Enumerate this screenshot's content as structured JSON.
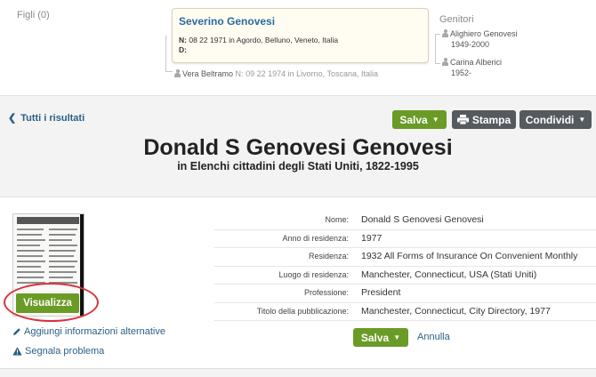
{
  "family": {
    "children_label": "Figli (0)",
    "person": {
      "name": "Severino Genovesi",
      "birth_label": "N:",
      "birth_value": "08 22 1971 in Agordo, Belluno, Veneto, Italia",
      "death_label": "D:",
      "death_value": ""
    },
    "spouse": {
      "name": "Vera Beltramo",
      "birth_label": "N:",
      "birth_value": "09 22 1974 in Livorno, Toscana, Italia"
    },
    "parents_title": "Genitori",
    "parents": [
      {
        "name": "Alighiero Genovesi",
        "dates": "1949-2000"
      },
      {
        "name": "Carina Alberici",
        "dates": "1952-"
      }
    ]
  },
  "header": {
    "back_label": "Tutti i risultati",
    "save_label": "Salva",
    "print_label": "Stampa",
    "share_label": "Condividi",
    "title": "Donald S Genovesi Genovesi",
    "subtitle": "in Elenchi cittadini degli Stati Uniti, 1822-1995"
  },
  "record": {
    "view_label": "Visualizza",
    "add_alt_label": "Aggiungi informazioni alternative",
    "report_label": "Segnala problema",
    "fields": [
      {
        "label": "Nome:",
        "value": "Donald S Genovesi Genovesi"
      },
      {
        "label": "Anno di residenza:",
        "value": "1977"
      },
      {
        "label": "Residenza:",
        "value": "1932 All Forms of Insurance On Convenient Monthly"
      },
      {
        "label": "Luogo di residenza:",
        "value": "Manchester, Connecticut, USA (Stati Uniti)"
      },
      {
        "label": "Professione:",
        "value": "President"
      },
      {
        "label": "Titolo della pubblicazione:",
        "value": "Manchester, Connecticut, City Directory, 1977"
      }
    ],
    "save_label": "Salva",
    "cancel_label": "Annulla"
  },
  "colors": {
    "accent_green": "#6a9b26",
    "link_blue": "#2b5f86",
    "button_grey": "#555a5f",
    "highlight_ring": "#d9323a"
  },
  "icons": [
    "person-icon",
    "chevron-left-icon",
    "caret-down-icon",
    "printer-icon",
    "pencil-icon",
    "warning-icon"
  ]
}
